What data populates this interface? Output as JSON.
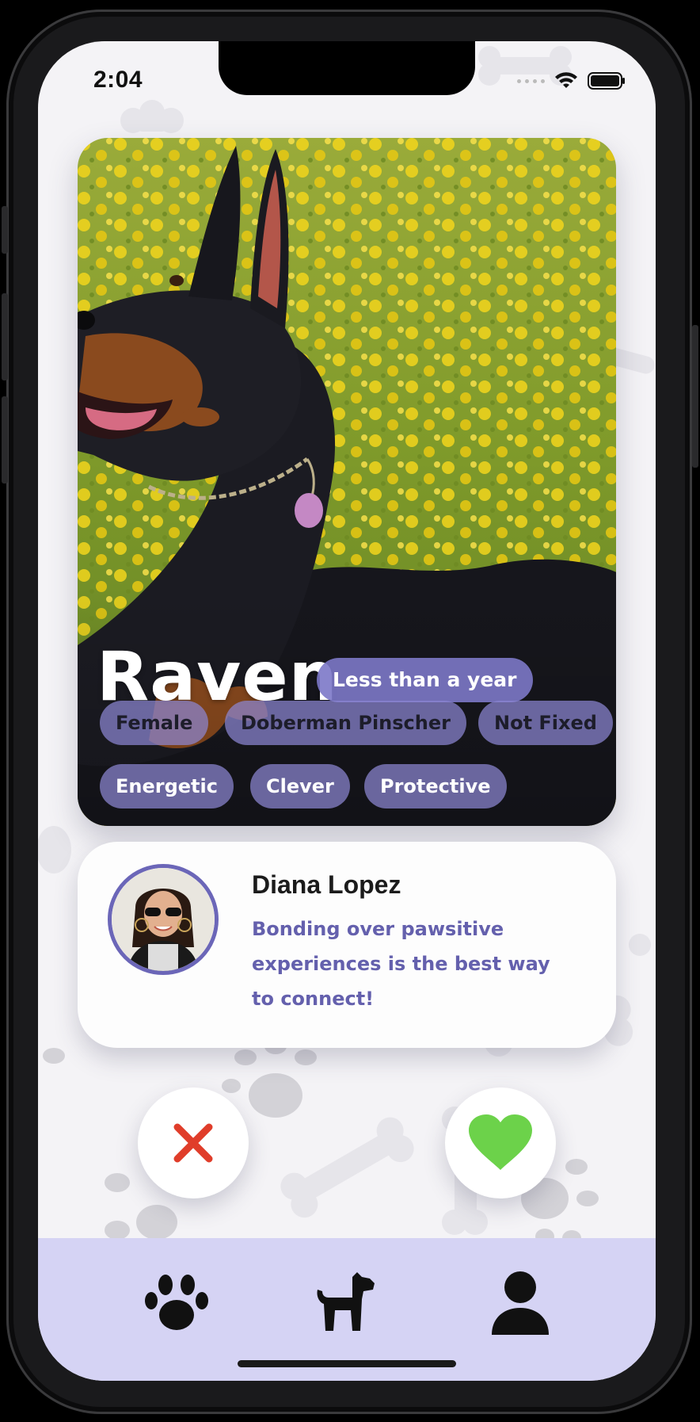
{
  "status_bar": {
    "time": "2:04"
  },
  "pet": {
    "name": "Raven",
    "age": "Less than a year",
    "tags_row1": [
      "Female",
      "Doberman Pinscher",
      "Not Fixed"
    ],
    "tags_row2": [
      "Energetic",
      "Clever",
      "Protective"
    ],
    "photo_icon": "doberman-photo"
  },
  "owner": {
    "name": "Diana Lopez",
    "bio": "Bonding over pawsitive experiences is the best way to connect!"
  },
  "actions": {
    "reject_icon": "close-icon",
    "like_icon": "heart-icon"
  },
  "tab_bar": {
    "items": [
      "paw-icon",
      "dog-icon",
      "profile-icon"
    ]
  },
  "colors": {
    "accent": "#7c78c8",
    "tab_bar": "#d5d3f4",
    "reject": "#e03d2a",
    "like": "#6cd24a",
    "bio_text": "#6460ad"
  }
}
